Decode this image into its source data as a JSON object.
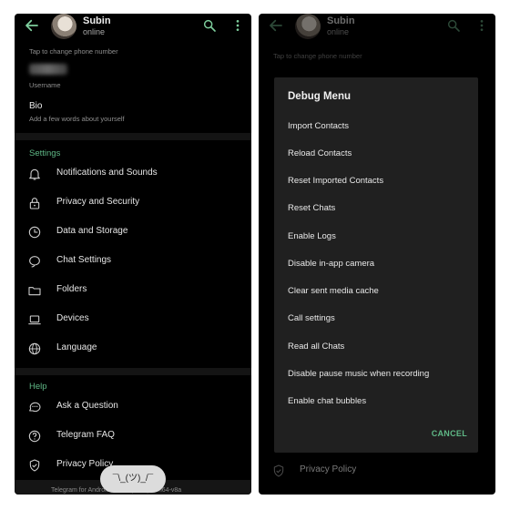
{
  "profile": {
    "name": "Subin",
    "status": "online",
    "phone_hint": "Tap to change phone number",
    "username_label": "Username",
    "bio_title": "Bio",
    "bio_hint": "Add a few words about yourself"
  },
  "settings": {
    "heading": "Settings",
    "items": [
      {
        "label": "Notifications and Sounds",
        "icon": "bell-icon"
      },
      {
        "label": "Privacy and Security",
        "icon": "lock-icon"
      },
      {
        "label": "Data and Storage",
        "icon": "clock-icon"
      },
      {
        "label": "Chat Settings",
        "icon": "chat-bubble-icon"
      },
      {
        "label": "Folders",
        "icon": "folder-icon"
      },
      {
        "label": "Devices",
        "icon": "laptop-icon"
      },
      {
        "label": "Language",
        "icon": "globe-icon"
      }
    ]
  },
  "help": {
    "heading": "Help",
    "items": [
      {
        "label": "Ask a Question",
        "icon": "chat-dots-icon"
      },
      {
        "label": "Telegram FAQ",
        "icon": "question-icon"
      },
      {
        "label": "Privacy Policy",
        "icon": "shield-check-icon"
      }
    ]
  },
  "footer": "Telegram for Android v7.1.1 (2140) arm64-v8a",
  "toast": "¯\\_(ツ)_/¯",
  "debug_menu": {
    "title": "Debug Menu",
    "items": [
      "Import Contacts",
      "Reload Contacts",
      "Reset Imported Contacts",
      "Reset Chats",
      "Enable Logs",
      "Disable in-app camera",
      "Clear sent media cache",
      "Call settings",
      "Read all Chats",
      "Disable pause music when recording",
      "Enable chat bubbles"
    ],
    "cancel": "CANCEL"
  },
  "colors": {
    "accent": "#5fb886",
    "background": "#000000",
    "dialog": "#202020"
  }
}
